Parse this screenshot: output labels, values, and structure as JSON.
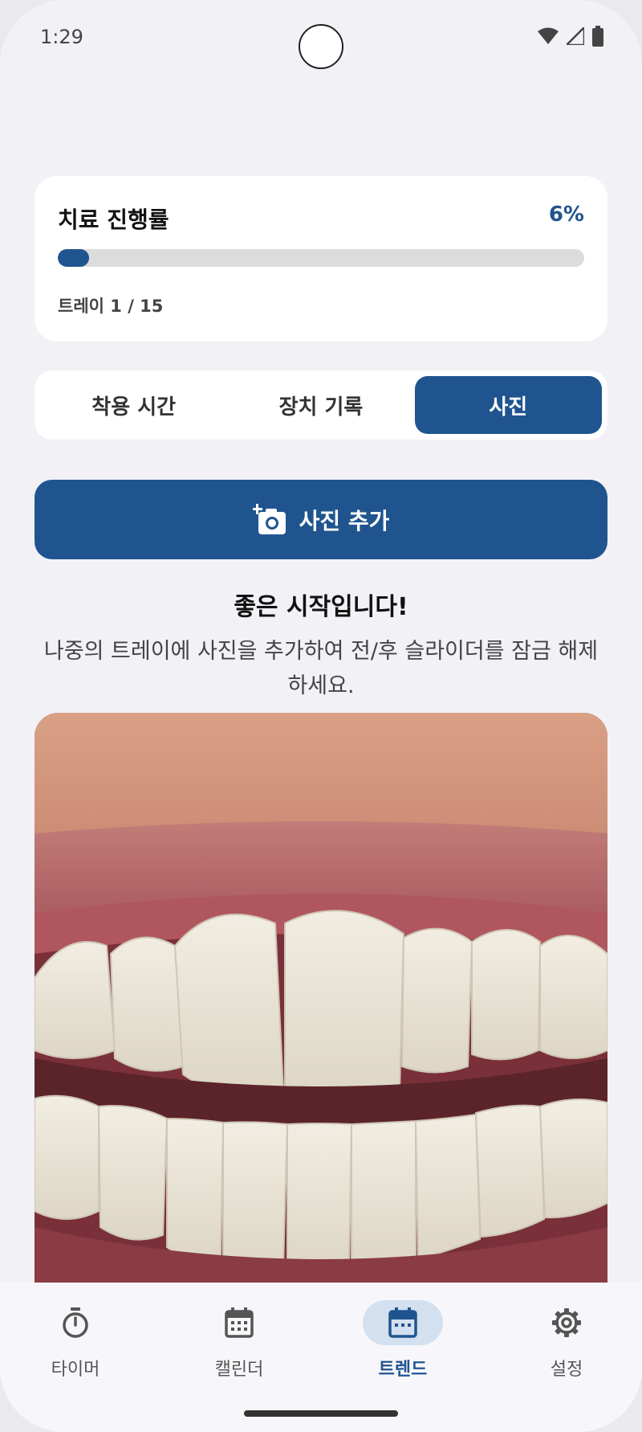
{
  "status_bar": {
    "time": "1:29"
  },
  "progress": {
    "title": "치료 진행률",
    "percent_label": "6%",
    "fill_fraction": 0.06,
    "tray_label": "트레이 1 / 15"
  },
  "tabs": [
    {
      "label": "착용 시간",
      "active": false
    },
    {
      "label": "장치 기록",
      "active": false
    },
    {
      "label": "사진",
      "active": true
    }
  ],
  "add_photo": {
    "label": "사진 추가",
    "icon": "add-photo-icon"
  },
  "message": {
    "title": "좋은 시작입니다!",
    "body": "나중의 트레이에 사진을 추가하여 전/후 슬라이더를 잠금 해제하세요."
  },
  "bottom_nav": [
    {
      "label": "타이머",
      "icon": "stopwatch-icon",
      "active": false
    },
    {
      "label": "캘린더",
      "icon": "calendar-icon",
      "active": false
    },
    {
      "label": "트렌드",
      "icon": "calendar-dots-icon",
      "active": true
    },
    {
      "label": "설정",
      "icon": "gear-icon",
      "active": false
    }
  ],
  "colors": {
    "accent": "#20548f",
    "background": "#f1f1f6",
    "card": "#ffffff"
  }
}
